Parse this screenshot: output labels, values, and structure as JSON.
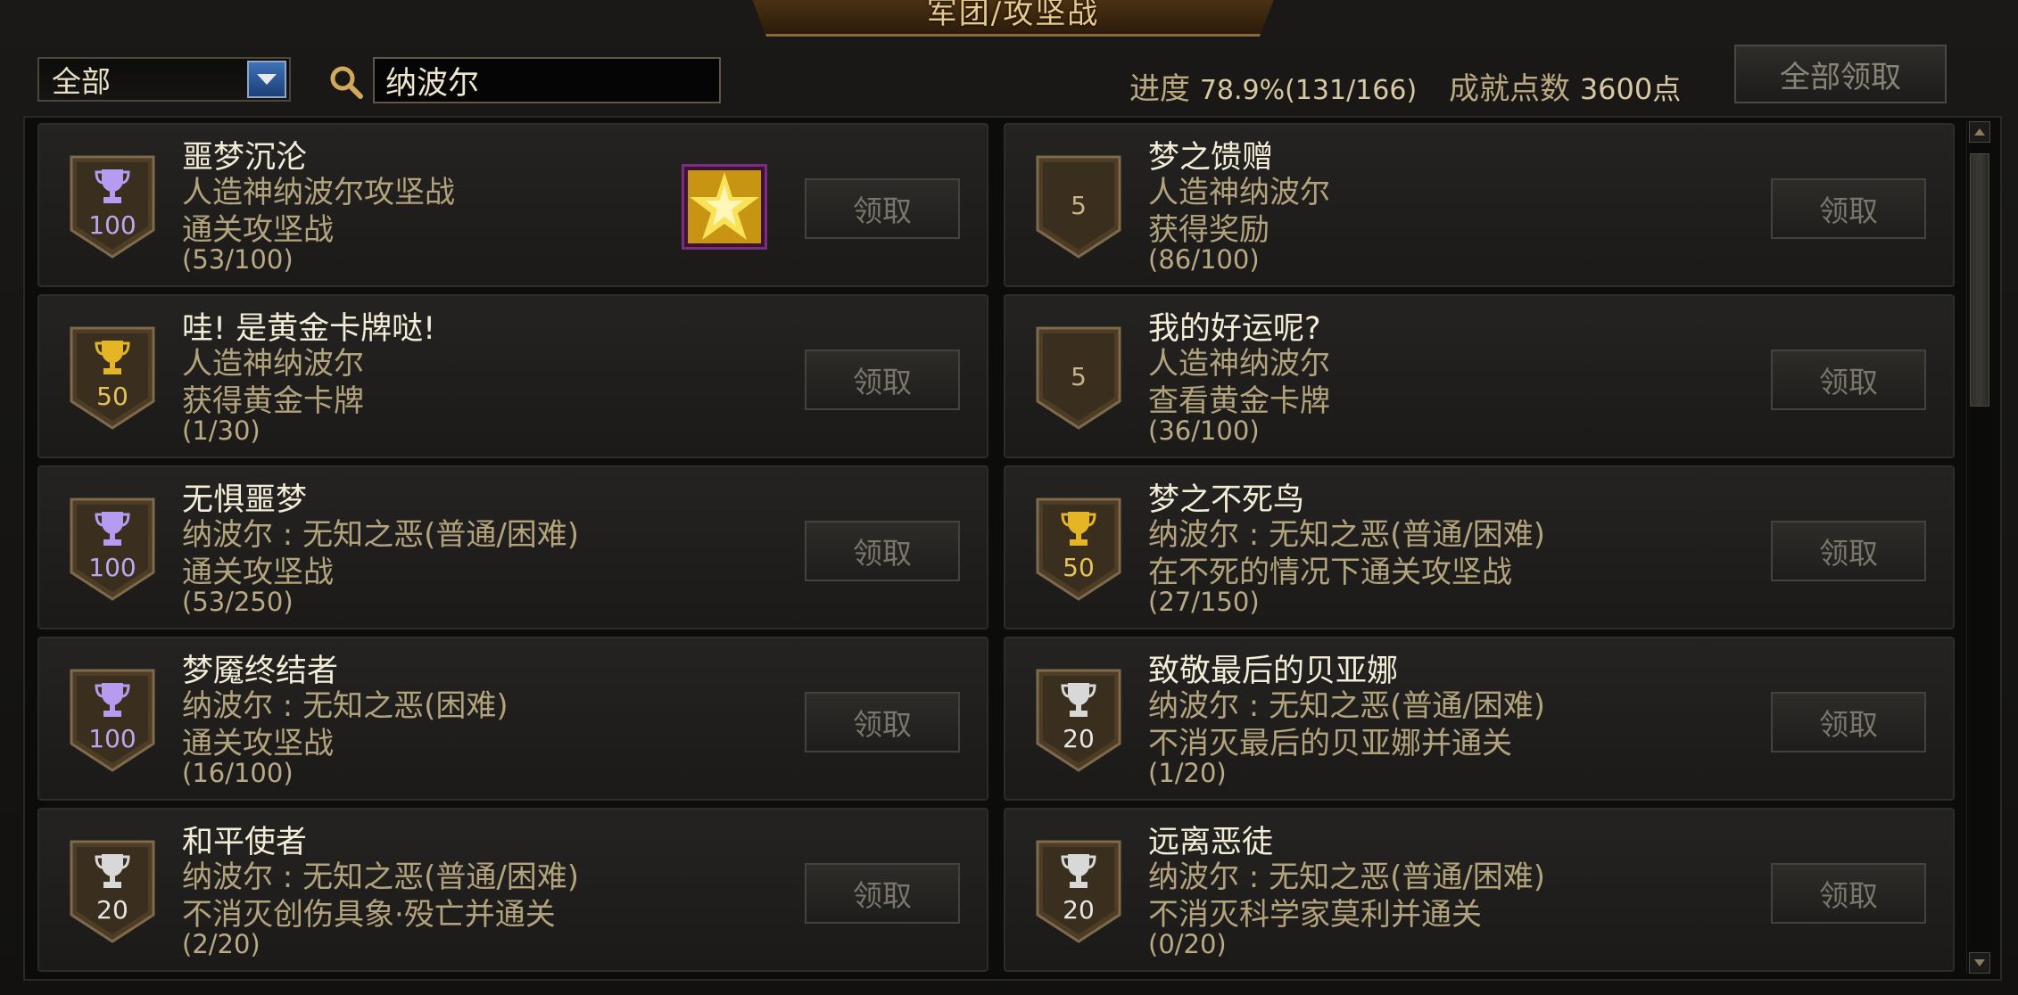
{
  "window": {
    "title": "军团/攻坚战"
  },
  "filter": {
    "selected": "全部"
  },
  "search": {
    "value": "纳波尔"
  },
  "progress": {
    "label": "进度",
    "value": "78.9%(131/166)"
  },
  "points": {
    "label": "成就点数",
    "value": "3600点"
  },
  "claim_all_label": "全部领取",
  "colors": {
    "purple_trophy": "#b59cf0",
    "gold_trophy": "#e6b526",
    "silver_trophy": "#d8d8d8",
    "shield": "#4d3d27"
  },
  "achievements": [
    {
      "title": "噩梦沉沦",
      "line1": "人造神纳波尔攻坚战",
      "line2": "通关攻坚战",
      "progress": "(53/100)",
      "points": "100",
      "trophy": "purple",
      "has_reward_item": true,
      "reward_icon": "golden-card-icon",
      "button": "领取"
    },
    {
      "title": "梦之馈赠",
      "line1": "人造神纳波尔",
      "line2": "获得奖励",
      "progress": "(86/100)",
      "points": "5",
      "trophy": "none",
      "button": "领取"
    },
    {
      "title": "哇! 是黄金卡牌哒!",
      "line1": "人造神纳波尔",
      "line2": "获得黄金卡牌",
      "progress": "(1/30)",
      "points": "50",
      "trophy": "gold",
      "button": "领取"
    },
    {
      "title": "我的好运呢?",
      "line1": "人造神纳波尔",
      "line2": "查看黄金卡牌",
      "progress": "(36/100)",
      "points": "5",
      "trophy": "none",
      "button": "领取"
    },
    {
      "title": "无惧噩梦",
      "line1": "纳波尔 : 无知之恶(普通/困难)",
      "line2": "通关攻坚战",
      "progress": "(53/250)",
      "points": "100",
      "trophy": "purple",
      "button": "领取"
    },
    {
      "title": "梦之不死鸟",
      "line1": "纳波尔 : 无知之恶(普通/困难)",
      "line2": "在不死的情况下通关攻坚战",
      "progress": "(27/150)",
      "points": "50",
      "trophy": "gold",
      "button": "领取"
    },
    {
      "title": "梦魇终结者",
      "line1": "纳波尔 : 无知之恶(困难)",
      "line2": "通关攻坚战",
      "progress": "(16/100)",
      "points": "100",
      "trophy": "purple",
      "button": "领取"
    },
    {
      "title": "致敬最后的贝亚娜",
      "line1": "纳波尔 : 无知之恶(普通/困难)",
      "line2": "不消灭最后的贝亚娜并通关",
      "progress": "(1/20)",
      "points": "20",
      "trophy": "silver",
      "button": "领取"
    },
    {
      "title": "和平使者",
      "line1": "纳波尔 : 无知之恶(普通/困难)",
      "line2": "不消灭创伤具象·殁亡并通关",
      "progress": "(2/20)",
      "points": "20",
      "trophy": "silver",
      "button": "领取"
    },
    {
      "title": "远离恶徒",
      "line1": "纳波尔 : 无知之恶(普通/困难)",
      "line2": "不消灭科学家莫利并通关",
      "progress": "(0/20)",
      "points": "20",
      "trophy": "silver",
      "button": "领取"
    }
  ]
}
